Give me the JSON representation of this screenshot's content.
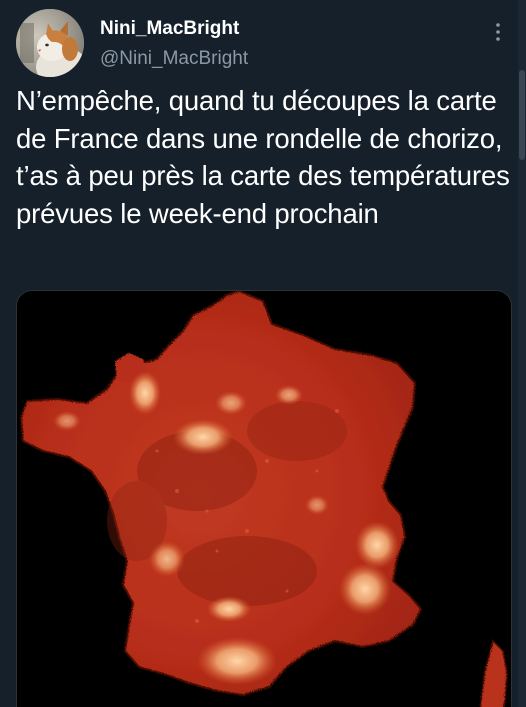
{
  "author": {
    "display_name": "Nini_MacBright",
    "handle": "@Nini_MacBright",
    "avatar_icon": "cat-avatar-icon"
  },
  "tweet": {
    "text": "N’empêche, quand tu découpes la carte de France dans une rondelle de chorizo, t’as à peu près la carte des températures prévues le week-end prochain"
  },
  "media": {
    "subject": "france-map-chorizo-image",
    "colors": {
      "background": "#000000",
      "chorizo": "#c8321c",
      "fat": "#f2b07a"
    }
  },
  "colors": {
    "background": "#15202b",
    "text": "#ffffff",
    "secondary": "#8b98a5"
  },
  "icons": {
    "more": "more-vertical-icon"
  }
}
